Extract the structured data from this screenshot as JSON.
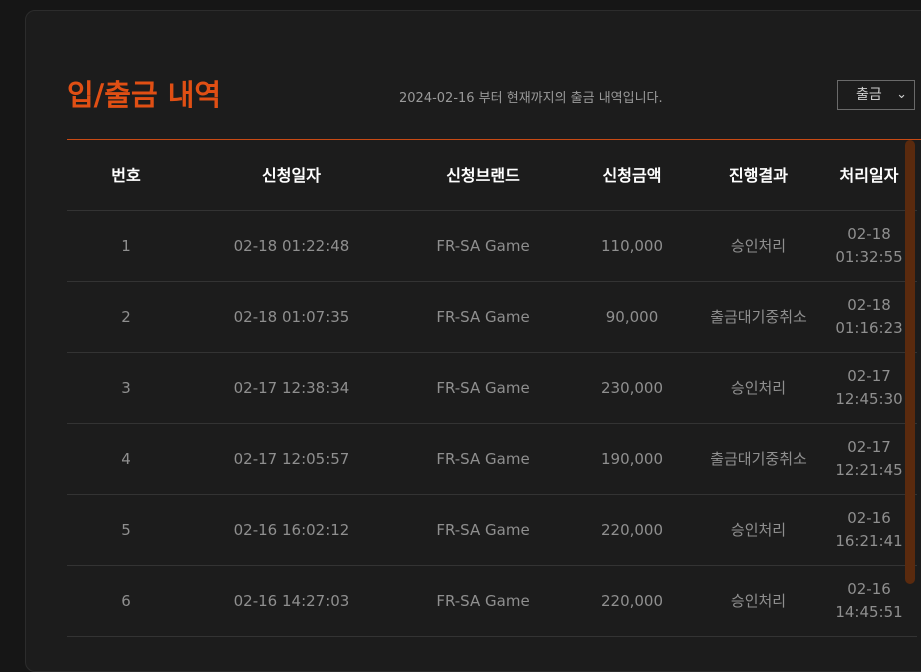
{
  "header": {
    "title": "입/출금 내역",
    "subtitle": "2024-02-16 부터 현재까지의 출금 내역입니다.",
    "filter_selected": "출금"
  },
  "table": {
    "columns": [
      "번호",
      "신청일자",
      "신청브랜드",
      "신청금액",
      "진행결과",
      "처리일자"
    ],
    "rows": [
      {
        "no": "1",
        "requested": "02-18 01:22:48",
        "brand": "FR-SA Game",
        "amount": "110,000",
        "result": "승인처리",
        "processed_date": "02-18",
        "processed_time": "01:32:55"
      },
      {
        "no": "2",
        "requested": "02-18 01:07:35",
        "brand": "FR-SA Game",
        "amount": "90,000",
        "result": "출금대기중취소",
        "processed_date": "02-18",
        "processed_time": "01:16:23"
      },
      {
        "no": "3",
        "requested": "02-17 12:38:34",
        "brand": "FR-SA Game",
        "amount": "230,000",
        "result": "승인처리",
        "processed_date": "02-17",
        "processed_time": "12:45:30"
      },
      {
        "no": "4",
        "requested": "02-17 12:05:57",
        "brand": "FR-SA Game",
        "amount": "190,000",
        "result": "출금대기중취소",
        "processed_date": "02-17",
        "processed_time": "12:21:45"
      },
      {
        "no": "5",
        "requested": "02-16 16:02:12",
        "brand": "FR-SA Game",
        "amount": "220,000",
        "result": "승인처리",
        "processed_date": "02-16",
        "processed_time": "16:21:41"
      },
      {
        "no": "6",
        "requested": "02-16 14:27:03",
        "brand": "FR-SA Game",
        "amount": "220,000",
        "result": "승인처리",
        "processed_date": "02-16",
        "processed_time": "14:45:51"
      }
    ]
  },
  "colors": {
    "accent": "#e04f14",
    "background": "#1c1c1c",
    "scrollbar": "#5a2a0e"
  },
  "icons": {
    "select_chevron": "chevron-down-icon"
  }
}
